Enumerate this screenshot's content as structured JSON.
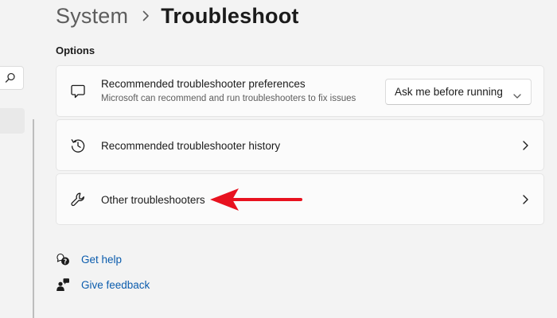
{
  "breadcrumb": {
    "parent": "System",
    "current": "Troubleshoot"
  },
  "options_label": "Options",
  "cards": [
    {
      "title": "Recommended troubleshooter preferences",
      "subtitle": "Microsoft can recommend and run troubleshooters to fix issues",
      "icon": "chat-bubble-icon",
      "dropdown_value": "Ask me before running"
    },
    {
      "title": "Recommended troubleshooter history",
      "icon": "history-icon"
    },
    {
      "title": "Other troubleshooters",
      "icon": "wrench-icon"
    }
  ],
  "links": [
    {
      "label": "Get help",
      "icon": "help-icon"
    },
    {
      "label": "Give feedback",
      "icon": "feedback-icon"
    }
  ],
  "annotation": {
    "type": "red-arrow",
    "color": "#e8121f",
    "points_to": "Other troubleshooters"
  },
  "colors": {
    "background": "#f3f3f3",
    "card": "#fbfbfb",
    "link": "#0b5cad",
    "arrow": "#e8121f"
  }
}
